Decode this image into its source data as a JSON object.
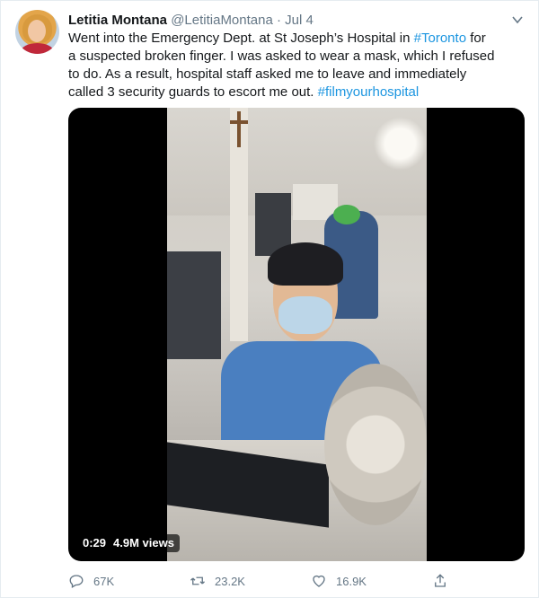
{
  "tweet": {
    "author_name": "Letitia Montana",
    "author_handle": "@LetitiaMontana",
    "separator": "·",
    "date": "Jul 4",
    "lines": [
      {
        "pre": "Went into the Emergency Dept. at St Joseph’s Hospital in ",
        "link": "#Toronto",
        "post": " for"
      },
      {
        "pre": "a suspected broken finger. I was asked to wear a mask, which I refused",
        "link": "",
        "post": ""
      },
      {
        "pre": "to do. As a result, hospital staff asked me to leave and immediately",
        "link": "",
        "post": ""
      },
      {
        "pre": "called 3 security guards to escort me out. ",
        "link": "#filmyourhospital",
        "post": ""
      }
    ]
  },
  "video": {
    "duration": "0:29",
    "views": "4.9M views"
  },
  "actions": {
    "reply_count": "67K",
    "retweet_count": "23.2K",
    "like_count": "16.9K"
  },
  "icons": {
    "caret": "chevron-down-icon",
    "reply": "reply-icon",
    "retweet": "retweet-icon",
    "like": "heart-icon",
    "share": "share-icon"
  },
  "colors": {
    "link": "#1b95e0",
    "muted": "#657786",
    "text": "#14171a",
    "scrub": "#0d5fa8"
  }
}
